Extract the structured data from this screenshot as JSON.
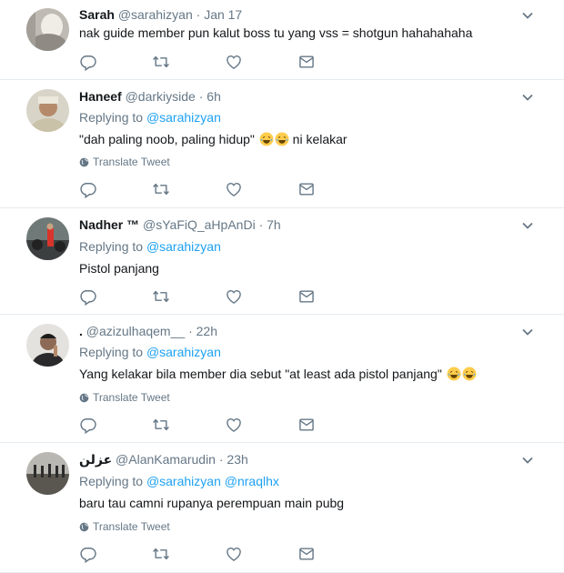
{
  "tweets": [
    {
      "name": "Sarah",
      "handle": "@sarahizyan",
      "time": "Jan 17",
      "text": "nak guide member pun kalut boss tu yang vss = shotgun hahahahaha"
    },
    {
      "name": "Haneef",
      "handle": "@darkiyside",
      "time": "6h",
      "replying_label": "Replying to",
      "reply_to": "@sarahizyan",
      "text": "\"dah paling noob, paling hidup\"",
      "text_after": " ni kelakar",
      "translate": "Translate Tweet"
    },
    {
      "name": "Nadher ™",
      "handle": "@sYaFiQ_aHpAnDi",
      "time": "7h",
      "replying_label": "Replying to",
      "reply_to": "@sarahizyan",
      "text": "Pistol panjang"
    },
    {
      "name": ".",
      "handle": "@azizulhaqem__",
      "time": "22h",
      "replying_label": "Replying to",
      "reply_to": "@sarahizyan",
      "text": "Yang kelakar bila member dia sebut \"at least ada pistol panjang\"",
      "translate": "Translate Tweet"
    },
    {
      "name": "عزلن",
      "handle": "@AlanKamarudin",
      "time": "23h",
      "replying_label": "Replying to",
      "reply_to": "@sarahizyan",
      "reply_to_2": "@nraqlhx",
      "text": "baru tau camni rupanya perempuan main pubg",
      "translate": "Translate Tweet"
    }
  ],
  "separator": "·",
  "icons": [
    "reply-icon",
    "retweet-icon",
    "like-icon",
    "dm-icon",
    "caret-down-icon",
    "globe-icon",
    "laughing-emoji-icon"
  ],
  "colors": {
    "accent": "#1da1f2",
    "muted": "#657786",
    "border": "#e6ecf0"
  }
}
